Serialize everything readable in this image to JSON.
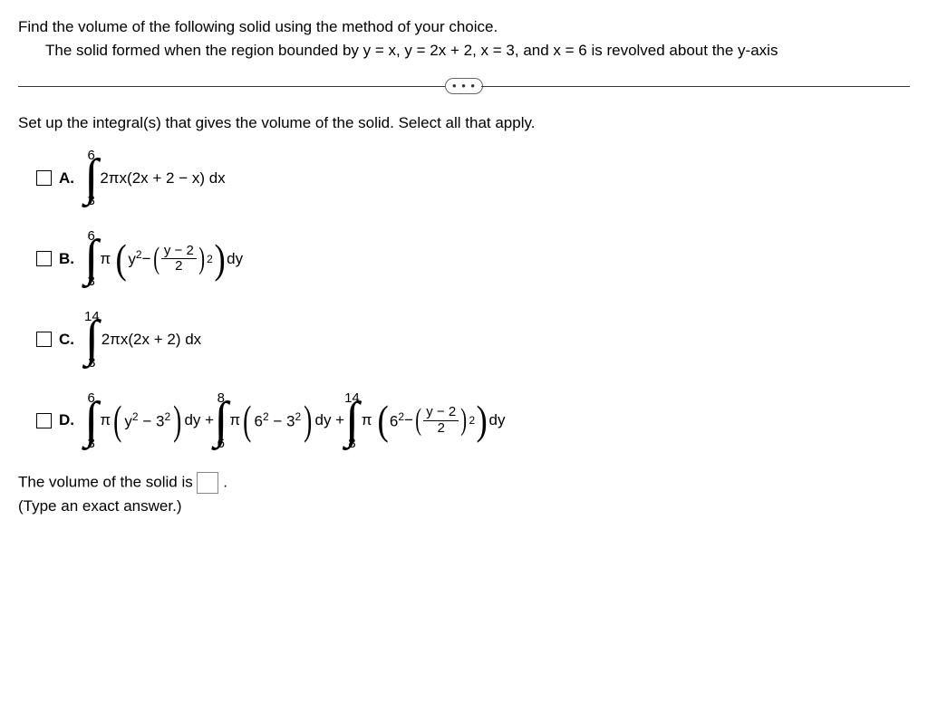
{
  "q_line1": "Find the volume of the following solid using the method of your choice.",
  "q_line2": "The solid formed when the region bounded by y = x, y = 2x + 2, x = 3, and x = 6 is revolved about the y-axis",
  "ellipsis": "• • •",
  "instruction": "Set up the integral(s) that gives the volume of the solid. Select all that apply.",
  "labels": {
    "A": "A.",
    "B": "B.",
    "C": "C.",
    "D": "D."
  },
  "A": {
    "top": "6",
    "bot": "3",
    "body": "2πx(2x + 2 − x) dx"
  },
  "B": {
    "top": "6",
    "bot": "3",
    "pi": "π",
    "y2": "y",
    "sup2": "2",
    "minus": " − ",
    "fnum": "y − 2",
    "fden": "2",
    "outsup": "2",
    "dy": " dy"
  },
  "C": {
    "top": "14",
    "bot": "3",
    "body": "2πx(2x + 2) dx"
  },
  "D": {
    "seg1": {
      "top": "6",
      "bot": "3",
      "pi": "π",
      "in1": "y",
      "s1": "2",
      "minus": " − 3",
      "s2": "2",
      "dy": " dy + "
    },
    "seg2": {
      "top": "8",
      "bot": "6",
      "pi": "π",
      "in1": "6",
      "s1": "2",
      "minus": " − 3",
      "s2": "2",
      "dy": " dy + "
    },
    "seg3": {
      "top": "14",
      "bot": "8",
      "pi": "π",
      "in1": "6",
      "s1": "2",
      "minus": " − ",
      "fnum": "y − 2",
      "fden": "2",
      "outsup": "2",
      "dy": " dy"
    }
  },
  "vol_pre": "The volume of the solid is ",
  "vol_post": ".",
  "hint": "(Type an exact answer.)"
}
